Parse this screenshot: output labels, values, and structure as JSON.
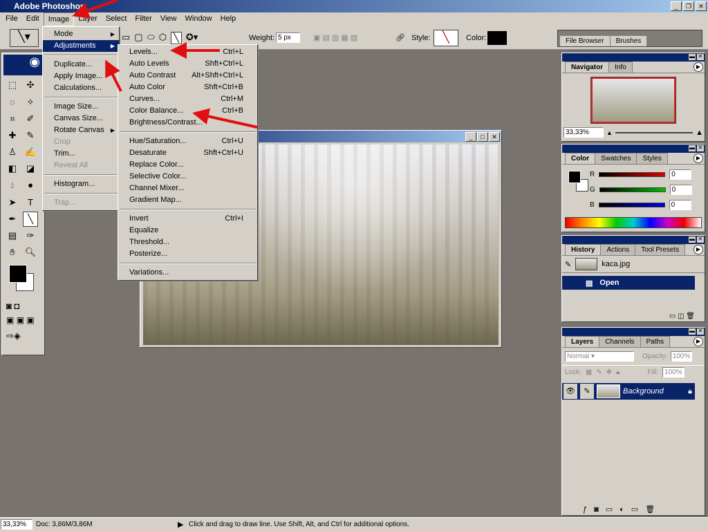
{
  "app": {
    "title": "Adobe Photoshop"
  },
  "menubar": [
    "File",
    "Edit",
    "Image",
    "Layer",
    "Select",
    "Filter",
    "View",
    "Window",
    "Help"
  ],
  "options": {
    "weight_label": "Weight:",
    "weight_value": "5 px",
    "style_label": "Style:",
    "color_label": "Color:",
    "tabs": [
      "File Browser",
      "Brushes"
    ]
  },
  "image_menu": [
    {
      "label": "Mode",
      "submenu": true
    },
    {
      "label": "Adjustments",
      "submenu": true,
      "highlight": true
    },
    {
      "sep": true
    },
    {
      "label": "Duplicate..."
    },
    {
      "label": "Apply Image..."
    },
    {
      "label": "Calculations..."
    },
    {
      "sep": true
    },
    {
      "label": "Image Size..."
    },
    {
      "label": "Canvas Size..."
    },
    {
      "label": "Rotate Canvas",
      "submenu": true
    },
    {
      "label": "Crop",
      "disabled": true
    },
    {
      "label": "Trim..."
    },
    {
      "label": "Reveal All",
      "disabled": true
    },
    {
      "sep": true
    },
    {
      "label": "Histogram..."
    },
    {
      "sep": true
    },
    {
      "label": "Trap...",
      "disabled": true
    }
  ],
  "adjust_menu": [
    {
      "label": "Levels...",
      "shortcut": "Ctrl+L"
    },
    {
      "label": "Auto Levels",
      "shortcut": "Shft+Ctrl+L"
    },
    {
      "label": "Auto Contrast",
      "shortcut": "Alt+Shft+Ctrl+L"
    },
    {
      "label": "Auto Color",
      "shortcut": "Shft+Ctrl+B"
    },
    {
      "label": "Curves...",
      "shortcut": "Ctrl+M"
    },
    {
      "label": "Color Balance...",
      "shortcut": "Ctrl+B"
    },
    {
      "label": "Brightness/Contrast..."
    },
    {
      "sep": true
    },
    {
      "label": "Hue/Saturation...",
      "shortcut": "Ctrl+U"
    },
    {
      "label": "Desaturate",
      "shortcut": "Shft+Ctrl+U"
    },
    {
      "label": "Replace Color..."
    },
    {
      "label": "Selective Color..."
    },
    {
      "label": "Channel Mixer..."
    },
    {
      "label": "Gradient Map..."
    },
    {
      "sep": true
    },
    {
      "label": "Invert",
      "shortcut": "Ctrl+I"
    },
    {
      "label": "Equalize"
    },
    {
      "label": "Threshold..."
    },
    {
      "label": "Posterize..."
    },
    {
      "sep": true
    },
    {
      "label": "Variations..."
    }
  ],
  "navigator": {
    "tabs": [
      "Navigator",
      "Info"
    ],
    "zoom": "33,33%"
  },
  "color": {
    "tabs": [
      "Color",
      "Swatches",
      "Styles"
    ],
    "channels": [
      {
        "label": "R",
        "value": "0",
        "color": "#e00000"
      },
      {
        "label": "G",
        "value": "0",
        "color": "#00c000"
      },
      {
        "label": "B",
        "value": "0",
        "color": "#0000e0"
      }
    ]
  },
  "history": {
    "tabs": [
      "History",
      "Actions",
      "Tool Presets"
    ],
    "snapshot": "kaca.jpg",
    "items": [
      "Open"
    ]
  },
  "layers": {
    "tabs": [
      "Layers",
      "Channels",
      "Paths"
    ],
    "blend_mode": "Normal",
    "opacity_label": "Opacity:",
    "opacity": "100%",
    "lock_label": "Lock:",
    "fill_label": "Fill:",
    "fill": "100%",
    "layer_name": "Background"
  },
  "status": {
    "zoom": "33,33%",
    "doc": "Doc: 3,86M/3,86M",
    "hint": "Click and drag to draw line. Use Shift, Alt, and Ctrl for additional options."
  },
  "colors": {
    "highlight": "#0a246a",
    "arrow": "#e01010"
  }
}
